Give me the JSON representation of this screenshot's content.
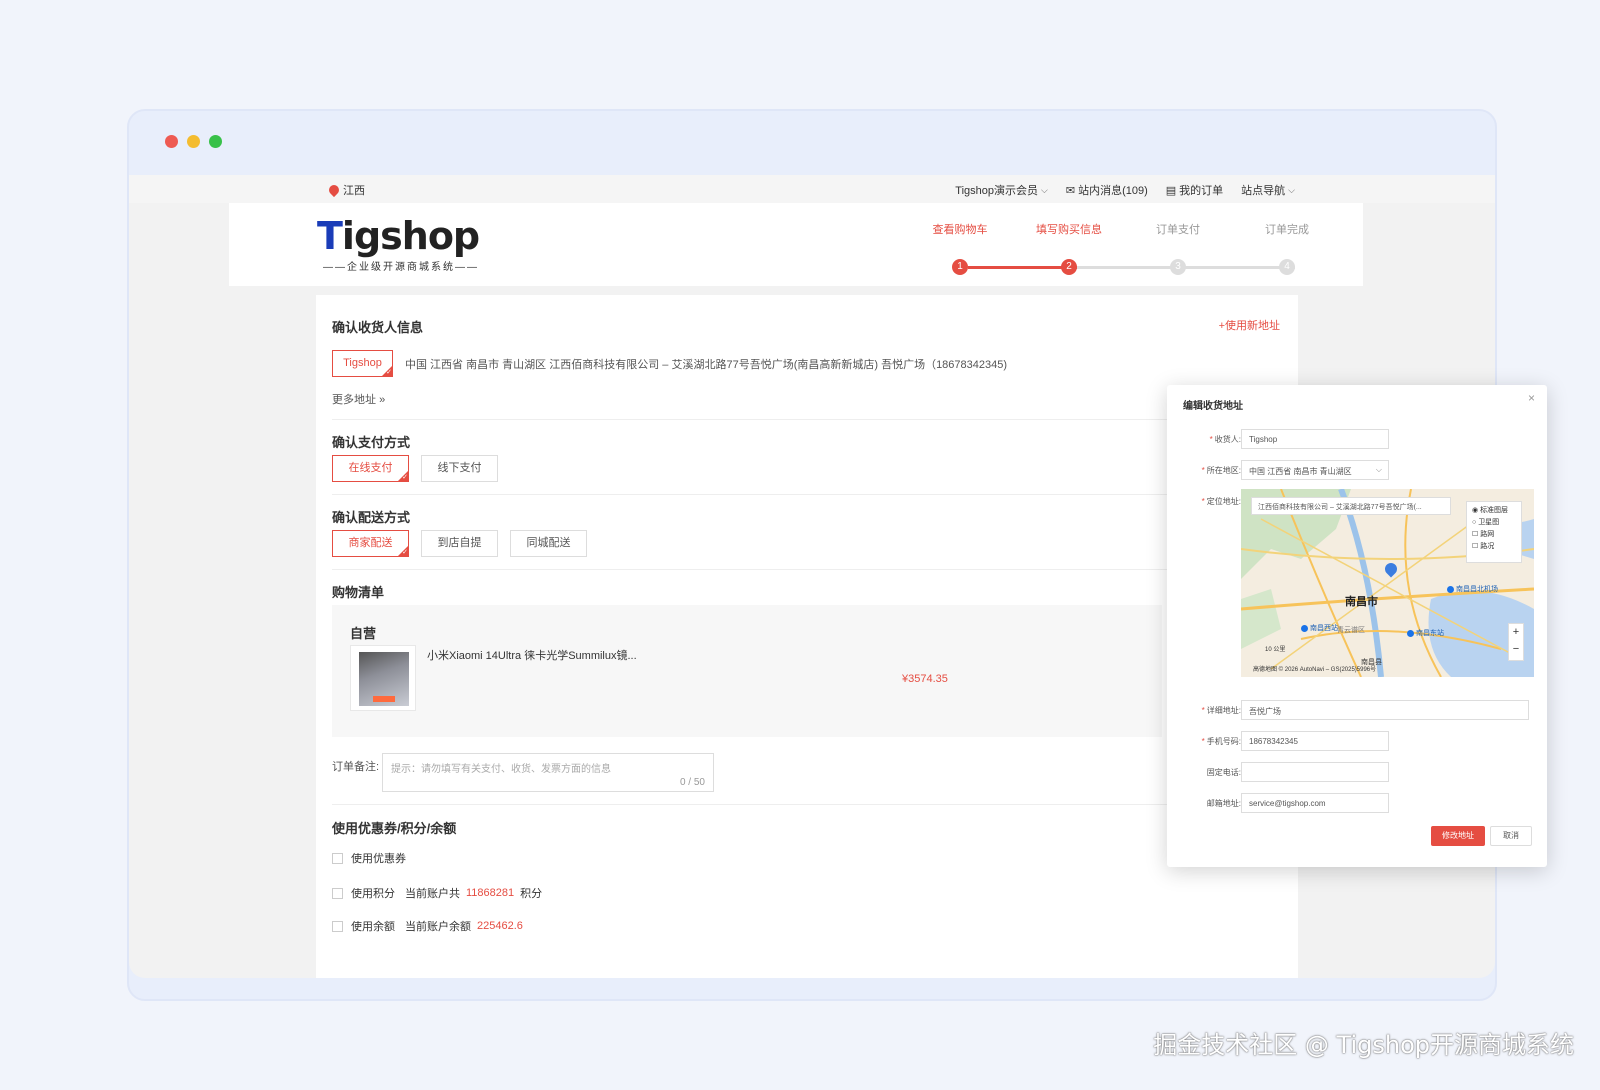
{
  "colors": {
    "accent": "#e54d42",
    "brand_blue": "#1a3cb8",
    "step_inactive": "#dddddd"
  },
  "topbar": {
    "location": "江西",
    "member": "Tigshop演示会员",
    "messages": "站内消息(109)",
    "orders": "我的订单",
    "site_nav": "站点导航"
  },
  "logo": {
    "name": "Tigshop",
    "tagline": "——企业级开源商城系统——"
  },
  "steps": [
    {
      "label": "查看购物车",
      "num": "1"
    },
    {
      "label": "填写购买信息",
      "num": "2"
    },
    {
      "label": "订单支付",
      "num": "3"
    },
    {
      "label": "订单完成",
      "num": "4"
    }
  ],
  "consignee": {
    "title": "确认收货人信息",
    "new_address": "+使用新地址",
    "selected_name": "Tigshop",
    "address": "中国 江西省 南昌市 青山湖区 江西佰商科技有限公司 – 艾溪湖北路77号吾悦广场(南昌高新新城店) 吾悦广场（18678342345)",
    "more": "更多地址"
  },
  "payment": {
    "title": "确认支付方式",
    "options": [
      "在线支付",
      "线下支付"
    ]
  },
  "delivery": {
    "title": "确认配送方式",
    "options": [
      "商家配送",
      "到店自提",
      "同城配送"
    ]
  },
  "cart": {
    "title": "购物清单",
    "shop": "自营",
    "product_name": "小米Xiaomi 14Ultra 徕卡光学Summilux镜...",
    "price": "¥3574.35"
  },
  "remark": {
    "label": "订单备注:",
    "placeholder": "提示：请勿填写有关支付、收货、发票方面的信息",
    "count": "0 / 50"
  },
  "discount": {
    "title": "使用优惠券/积分/余额",
    "coupon": "使用优惠券",
    "points_label": "使用积分",
    "points_prefix": "当前账户共",
    "points_value": "11868281",
    "points_suffix": "积分",
    "balance_label": "使用余额",
    "balance_prefix": "当前账户余额",
    "balance_value": "225462.6"
  },
  "dialog": {
    "title": "编辑收货地址",
    "close": "×",
    "fields": {
      "consignee_label": "收货人:",
      "consignee_value": "Tigshop",
      "region_label": "所在地区:",
      "region_value": "中国 江西省 南昌市 青山湖区",
      "locate_label": "定位地址:",
      "detail_label": "详细地址:",
      "detail_value": "吾悦广场",
      "mobile_label": "手机号码:",
      "mobile_value": "18678342345",
      "phone_label": "固定电话:",
      "phone_value": "",
      "email_label": "邮箱地址:",
      "email_value": "service@tigshop.com"
    },
    "map": {
      "search_text": "江西佰商科技有限公司 – 艾溪湖北路77号吾悦广场(...",
      "layers": [
        "标准图层",
        "卫星图",
        "路网",
        "路况"
      ],
      "city": "南昌市",
      "pois": [
        "南昌西站",
        "南昌东站",
        "南昌昌北机场",
        "青云谱区",
        "南昌县"
      ],
      "scale": "10 公里",
      "footer": "高德地图 © 2026 AutoNavi – GS(2025)5996号",
      "zoom_in": "+",
      "zoom_out": "−"
    },
    "save": "修改地址",
    "cancel": "取消"
  },
  "watermark": "掘金技术社区 @ Tigshop开源商城系统"
}
